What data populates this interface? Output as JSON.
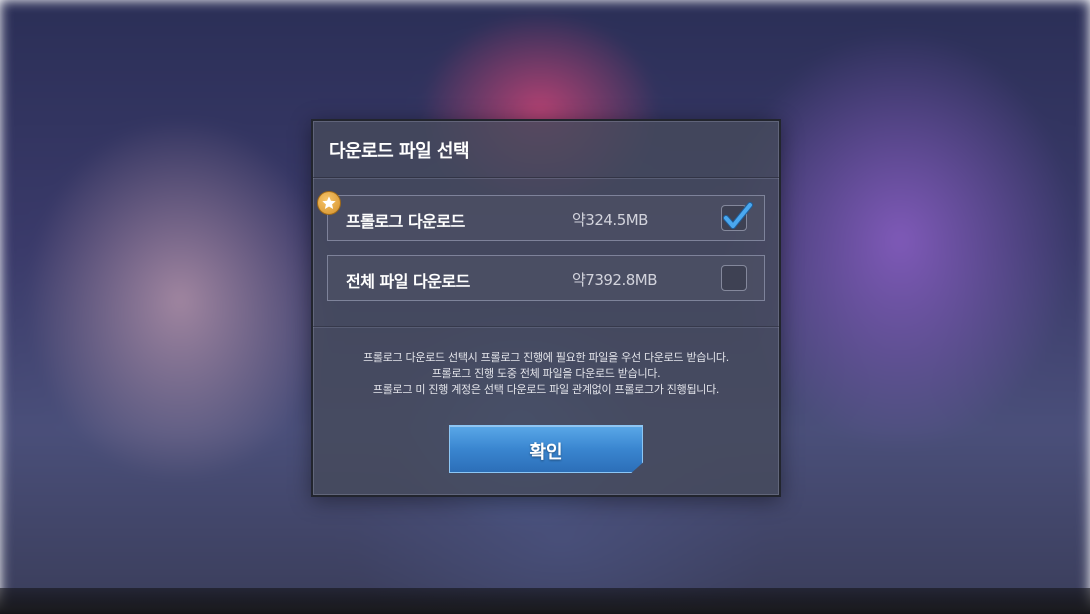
{
  "dialog": {
    "title": "다운로드 파일 선택",
    "options": [
      {
        "label": "프롤로그 다운로드",
        "size": "약324.5MB",
        "checked": true,
        "badge_icon": "star-icon"
      },
      {
        "label": "전체 파일 다운로드",
        "size": "약7392.8MB",
        "checked": false
      }
    ],
    "notice_lines": [
      "프롤로그 다운로드 선택시 프롤로그 진행에 필요한 파일을 우선 다운로드 받습니다.",
      "프롤로그 진행 도중 전체 파일을 다운로드 받습니다.",
      "프롤로그 미 진행 계정은 선택 다운로드 파일 관계없이 프롤로그가 진행됩니다."
    ],
    "confirm_label": "확인"
  },
  "colors": {
    "accent": "#3a86d0",
    "check": "#4aa8f0",
    "badge": "#e0a040"
  }
}
